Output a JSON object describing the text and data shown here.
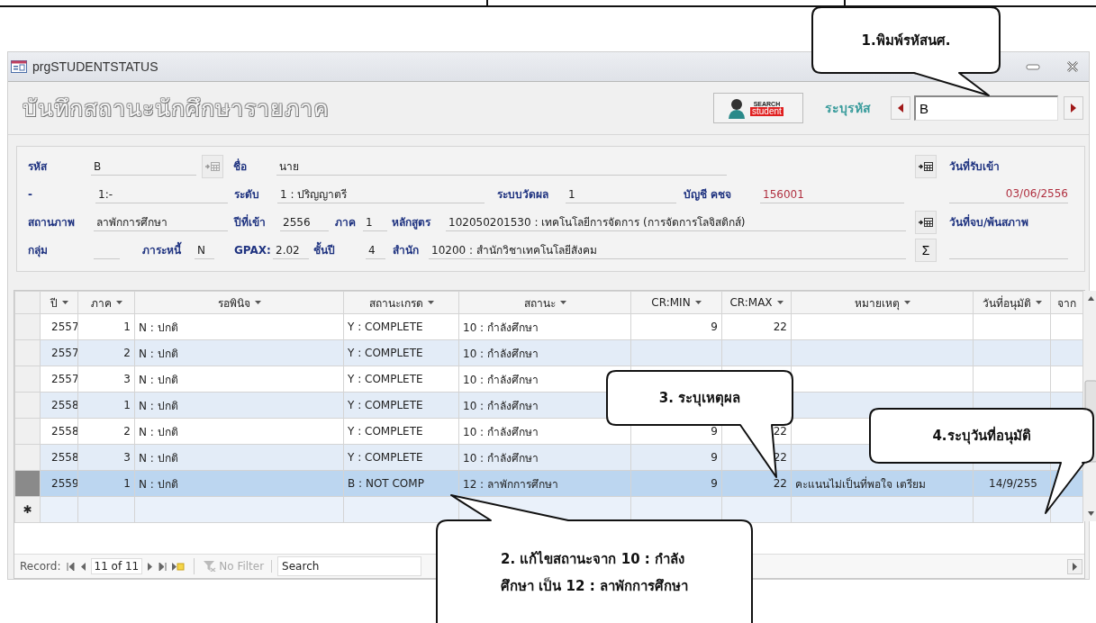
{
  "window": {
    "title": "prgSTUDENTSTATUS"
  },
  "header": {
    "title": "บันทึกสถานะนักศึกษารายภาค",
    "search_button": {
      "line_1": "SEARCH",
      "line_2": "student"
    },
    "id_label": "ระบุรหัส",
    "id_value": "B"
  },
  "form": {
    "rows": [
      {
        "left": [
          {
            "kind": "field",
            "label": "รหัส",
            "value": "B"
          },
          {
            "kind": "button"
          },
          {
            "kind": "field",
            "label": "ชื่อ",
            "value": "นาย"
          }
        ],
        "right": [
          {
            "kind": "button"
          },
          {
            "kind": "caption",
            "text": "วันที่รับเข้า"
          }
        ]
      },
      {
        "left": [
          {
            "kind": "field",
            "label": "-",
            "value": "1:-"
          },
          {
            "kind": "field",
            "label": "ระดับ",
            "value": "1 : ปริญญาตรี"
          },
          {
            "kind": "field",
            "label": "ระบบวัดผล",
            "value": "1"
          },
          {
            "kind": "field",
            "label": "บัญชี คชจ",
            "value": "156001",
            "accent": true
          }
        ],
        "right": [
          {
            "kind": "value",
            "value": "03/06/2556",
            "accent": true
          }
        ]
      },
      {
        "left": [
          {
            "kind": "field",
            "label": "สถานภาพ",
            "value": "ลาพักการศึกษา"
          },
          {
            "kind": "field",
            "label": "ปีที่เข้า",
            "value": "2556"
          },
          {
            "kind": "field",
            "label": "ภาค",
            "value": "1"
          },
          {
            "kind": "field",
            "label": "หลักสูตร",
            "value": "102050201530 : เทคโนโลยีการจัดการ (การจัดการโลจิสติกส์)"
          }
        ],
        "right": [
          {
            "kind": "button"
          },
          {
            "kind": "caption",
            "text": "วันที่จบ/พ้นสภาพ"
          }
        ]
      },
      {
        "left": [
          {
            "kind": "field",
            "label": "กลุ่ม"
          },
          {
            "kind": "field",
            "label": "ภาระหนี้",
            "value": "N"
          },
          {
            "kind": "field",
            "label": "GPAX:",
            "value": "2.02"
          },
          {
            "kind": "field",
            "label": "ชั้นปี",
            "value": "4"
          },
          {
            "kind": "field",
            "label": "สำนัก",
            "value": "10200 : สำนักวิชาเทคโนโลยีสังคม"
          }
        ],
        "right": [
          {
            "kind": "button",
            "text": "Σ"
          },
          {
            "kind": "value"
          }
        ]
      }
    ]
  },
  "table": {
    "columns": [
      "ปี",
      "ภาค",
      "รอพินิจ",
      "สถานะเกรด",
      "สถานะ",
      "CR:MIN",
      "CR:MAX",
      "หมายเหตุ",
      "วันที่อนุมัติ",
      "จาก"
    ],
    "rows": [
      {
        "year": "2557",
        "term": "1",
        "probation": "N : ปกติ",
        "grade_status": "Y : COMPLETE",
        "status": "10 : กำลังศึกษา",
        "cr_min": "9",
        "cr_max": "22",
        "selected": false
      },
      {
        "year": "2557",
        "term": "2",
        "probation": "N : ปกติ",
        "grade_status": "Y : COMPLETE",
        "status": "10 : กำลังศึกษา",
        "selected": false
      },
      {
        "year": "2557",
        "term": "3",
        "probation": "N : ปกติ",
        "grade_status": "Y : COMPLETE",
        "status": "10 : กำลังศึกษา",
        "selected": false
      },
      {
        "year": "2558",
        "term": "1",
        "probation": "N : ปกติ",
        "grade_status": "Y : COMPLETE",
        "status": "10 : กำลังศึกษา",
        "selected": false
      },
      {
        "year": "2558",
        "term": "2",
        "probation": "N : ปกติ",
        "grade_status": "Y : COMPLETE",
        "status": "10 : กำลังศึกษา",
        "cr_min": "9",
        "cr_max": "22",
        "selected": false
      },
      {
        "year": "2558",
        "term": "3",
        "probation": "N : ปกติ",
        "grade_status": "Y : COMPLETE",
        "status": "10 : กำลังศึกษา",
        "cr_min": "9",
        "cr_max": "22",
        "selected": false
      },
      {
        "year": "2559",
        "term": "1",
        "probation": "N : ปกติ",
        "grade_status": "B : NOT COMP",
        "status": "12 : ลาพักการศึกษา",
        "cr_min": "9",
        "cr_max": "22",
        "remark": "คะแนนไม่เป็นที่พอใจ เตรียม",
        "approved_date": "14/9/255",
        "selected": true
      }
    ],
    "new_row_mark": "✱"
  },
  "record_bar": {
    "label": "Record:",
    "position": "11 of 11",
    "filter": "No Filter",
    "filter_disabled": true,
    "search_placeholder": "Search"
  },
  "callouts": [
    {
      "lines": [
        "1.พิมพ์รหัสนศ."
      ]
    },
    {
      "lines": [
        "2. แก้ไขสถานะจาก 10 : กำลัง",
        "ศึกษา เป็น 12 : ลาพักการศึกษา"
      ]
    },
    {
      "lines": [
        "3. ระบุเหตุผล"
      ]
    },
    {
      "lines": [
        "4.ระบุวันที่อนุมัติ"
      ]
    }
  ]
}
